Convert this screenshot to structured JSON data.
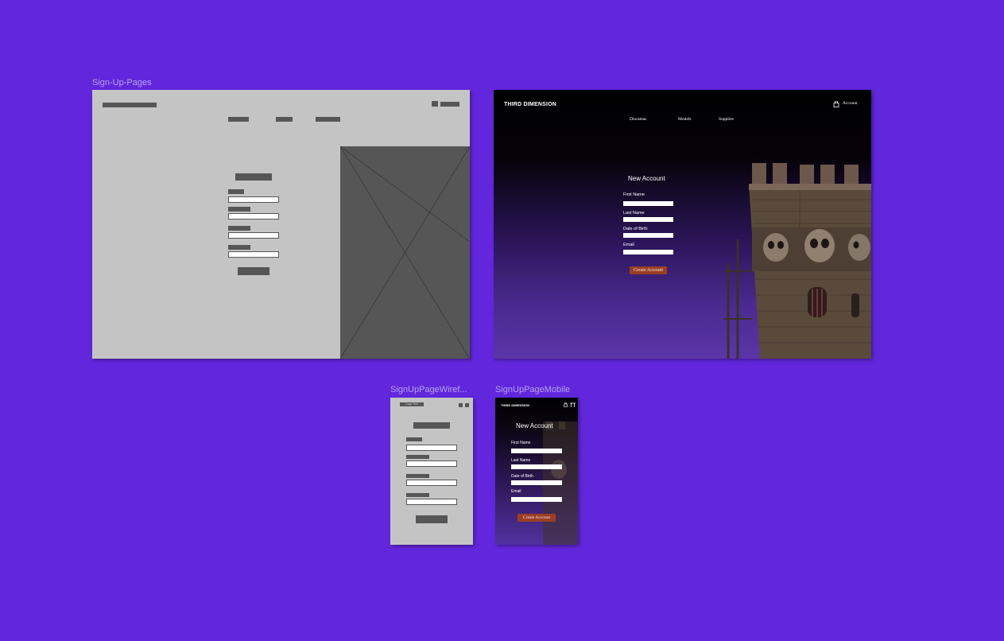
{
  "frames": {
    "sign_up_pages": "Sign-Up-Pages",
    "wireframe_mobile": "SignUpPageWiref...",
    "mobile": "SignUpPageMobile"
  },
  "desktop": {
    "brand": "THIRD DIMENSION",
    "account_label": "Account",
    "nav": [
      "Dioramas",
      "Models",
      "Supplies"
    ],
    "form_title": "New Account",
    "fields": [
      "First Name",
      "Last Name",
      "Date of Birth",
      "Email"
    ],
    "submit_label": "Create Account"
  },
  "mobile": {
    "brand": "THIRD DIMENSION",
    "form_title": "New Account",
    "fields": [
      "First Name",
      "Last Name",
      "Date of Birth",
      "Email"
    ],
    "submit_label": "Create Account"
  },
  "wireframe_mobile": {
    "header_label": "Logo Text"
  },
  "colors": {
    "canvas": "#6227dd",
    "wireframe_bg": "#c4c4c4",
    "wireframe_block": "#565656",
    "button": "#9a3f26"
  },
  "icons": {
    "cart": "shopping-bag-icon",
    "menu": "menu-icon"
  }
}
